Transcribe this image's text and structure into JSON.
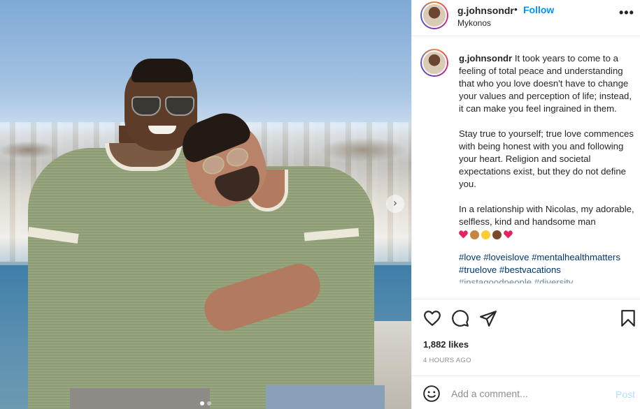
{
  "post": {
    "username": "g.johnsondr",
    "follow_label": "Follow",
    "separator": "•",
    "location": "Mykonos",
    "more_label": "•••",
    "next_arrow": "›",
    "caption": {
      "p1": "It took years to come to a feeling of total peace and understanding that who you love doesn't have to change your values and perception of life; instead, it can make you feel ingrained in them.",
      "p2": "Stay true to yourself; true love commences with being honest with you and following your heart. Religion and societal expectations exist, but they do not define you.",
      "p3": "In a relationship with Nicolas, my adorable, selfless, kind and handsome man",
      "tags_line1": "#love #loveislove #mentalhealthmatters",
      "tags_line2": "#truelove #bestvacations",
      "tags_line3": "#instagoodpeople #diversity"
    },
    "emojis": [
      "red-heart",
      "medium-skin-face",
      "yellow-heart-hands",
      "dark-skin-face",
      "red-heart"
    ],
    "likes": "1,882 likes",
    "time": "4 HOURS AGO",
    "photo_count": 2,
    "photo_active_index": 0
  },
  "comment": {
    "placeholder": "Add a comment...",
    "post_label": "Post"
  },
  "icons": {
    "like": "heart-outline-icon",
    "comment": "speech-bubble-icon",
    "share": "paper-plane-icon",
    "save": "bookmark-icon",
    "emoji": "smiley-icon"
  },
  "colors": {
    "link_blue": "#0095f6",
    "hashtag": "#00376b",
    "muted": "#8e8e8e",
    "post_disabled": "#b2dffc"
  }
}
